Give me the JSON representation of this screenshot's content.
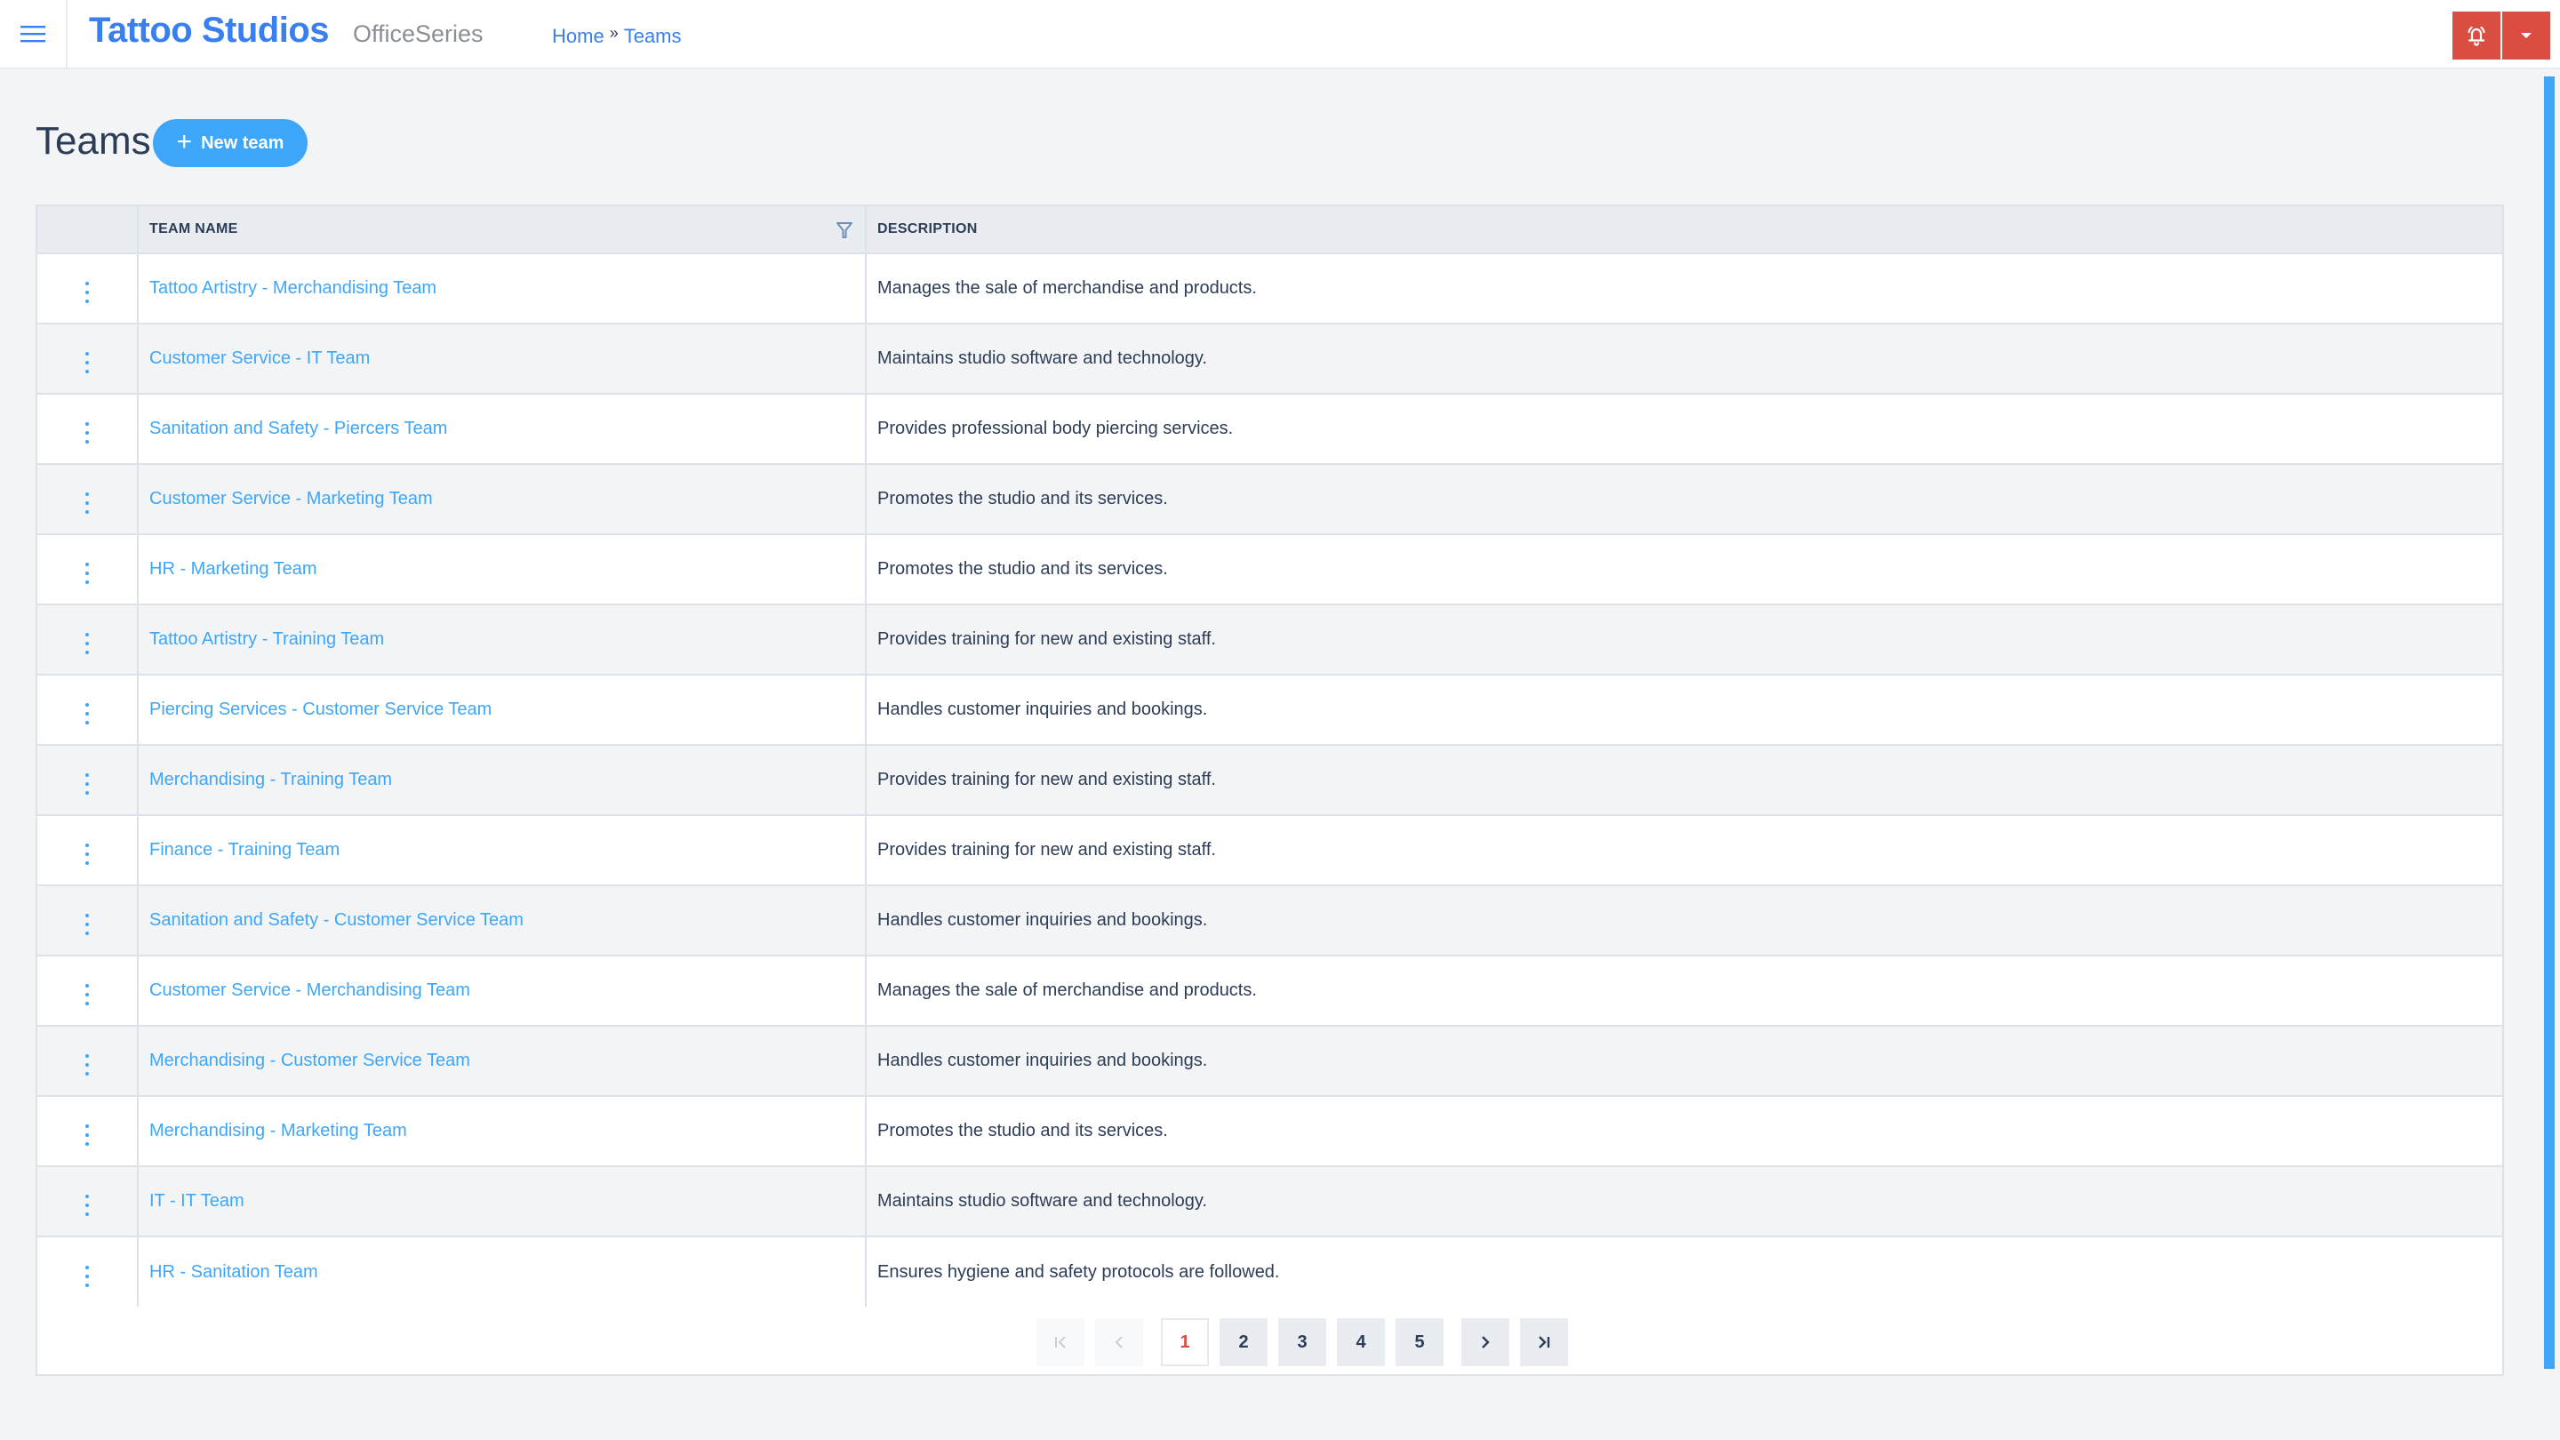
{
  "header": {
    "brand": "Tattoo Studios",
    "product": "OfficeSeries",
    "breadcrumb": [
      {
        "label": "Home"
      },
      {
        "label": "Teams"
      }
    ],
    "breadcrumb_separator": "»",
    "menu_icon": "hamburger-icon",
    "notification_icon": "bell-ringing-icon",
    "dropdown_icon": "caret-down-icon",
    "accent_color": "#3a7ff0",
    "action_color": "#d94e41"
  },
  "page": {
    "title": "Teams",
    "new_button_label": "New team",
    "new_button_icon": "plus-icon"
  },
  "table": {
    "columns": [
      {
        "label": ""
      },
      {
        "label": "TEAM NAME",
        "filter_icon": "filter-icon"
      },
      {
        "label": "DESCRIPTION"
      }
    ],
    "row_action_icon": "kebab-menu-icon",
    "rows": [
      {
        "name": "Tattoo Artistry - Merchandising Team",
        "description": "Manages the sale of merchandise and products."
      },
      {
        "name": "Customer Service - IT Team",
        "description": "Maintains studio software and technology."
      },
      {
        "name": "Sanitation and Safety - Piercers Team",
        "description": "Provides professional body piercing services."
      },
      {
        "name": "Customer Service - Marketing Team",
        "description": "Promotes the studio and its services."
      },
      {
        "name": "HR - Marketing Team",
        "description": "Promotes the studio and its services."
      },
      {
        "name": "Tattoo Artistry - Training Team",
        "description": "Provides training for new and existing staff."
      },
      {
        "name": "Piercing Services - Customer Service Team",
        "description": "Handles customer inquiries and bookings."
      },
      {
        "name": "Merchandising - Training Team",
        "description": "Provides training for new and existing staff."
      },
      {
        "name": "Finance - Training Team",
        "description": "Provides training for new and existing staff."
      },
      {
        "name": "Sanitation and Safety - Customer Service Team",
        "description": "Handles customer inquiries and bookings."
      },
      {
        "name": "Customer Service - Merchandising Team",
        "description": "Manages the sale of merchandise and products."
      },
      {
        "name": "Merchandising - Customer Service Team",
        "description": "Handles customer inquiries and bookings."
      },
      {
        "name": "Merchandising - Marketing Team",
        "description": "Promotes the studio and its services."
      },
      {
        "name": "IT - IT Team",
        "description": "Maintains studio software and technology."
      },
      {
        "name": "HR - Sanitation Team",
        "description": "Ensures hygiene and safety protocols are followed."
      }
    ]
  },
  "pagination": {
    "current_page": 1,
    "pages": [
      "1",
      "2",
      "3",
      "4",
      "5"
    ],
    "first_icon": "first-page-icon",
    "prev_icon": "chevron-left-icon",
    "next_icon": "chevron-right-icon",
    "last_icon": "last-page-icon",
    "first_disabled": true,
    "prev_disabled": true
  }
}
